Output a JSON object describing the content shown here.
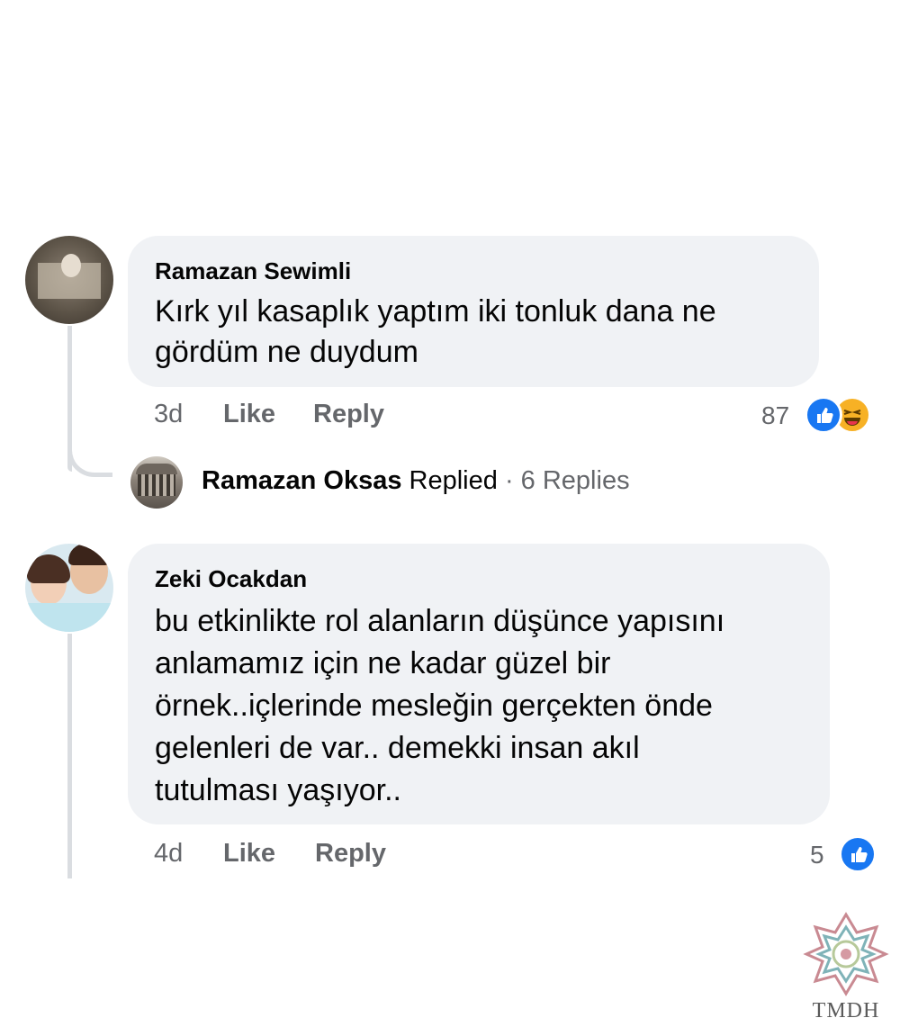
{
  "comments": [
    {
      "author": "Ramazan Sewimli",
      "text_line1": "Kırk yıl kasaplık yaptım iki tonluk dana ne",
      "text_line2": "gördüm ne duydum",
      "time": "3d",
      "like_label": "Like",
      "reply_label": "Reply",
      "reaction_count": "87",
      "reactions": [
        "like-icon",
        "haha-icon"
      ]
    },
    {
      "author": "Zeki Ocakdan",
      "text_line1": "bu etkinlikte rol alanların düşünce yapısını",
      "text_line2": "anlamamız için ne kadar güzel bir",
      "text_line3": "örnek..içlerinde mesleğin gerçekten önde",
      "text_line4": "gelenleri de var.. demekki insan akıl",
      "text_line5": "tutulması yaşıyor..",
      "time": "4d",
      "like_label": "Like",
      "reply_label": "Reply",
      "reaction_count": "5",
      "reactions": [
        "like-icon"
      ]
    }
  ],
  "reply_summary": {
    "name": "Ramazan Oksas",
    "action": "Replied",
    "separator": "·",
    "count_label": "6 Replies"
  },
  "watermark": {
    "text": "TMDH"
  },
  "colors": {
    "bubble": "#f0f2f5",
    "like_blue": "#1877f2",
    "haha_yellow": "#f7b125",
    "meta_gray": "#65676b"
  }
}
